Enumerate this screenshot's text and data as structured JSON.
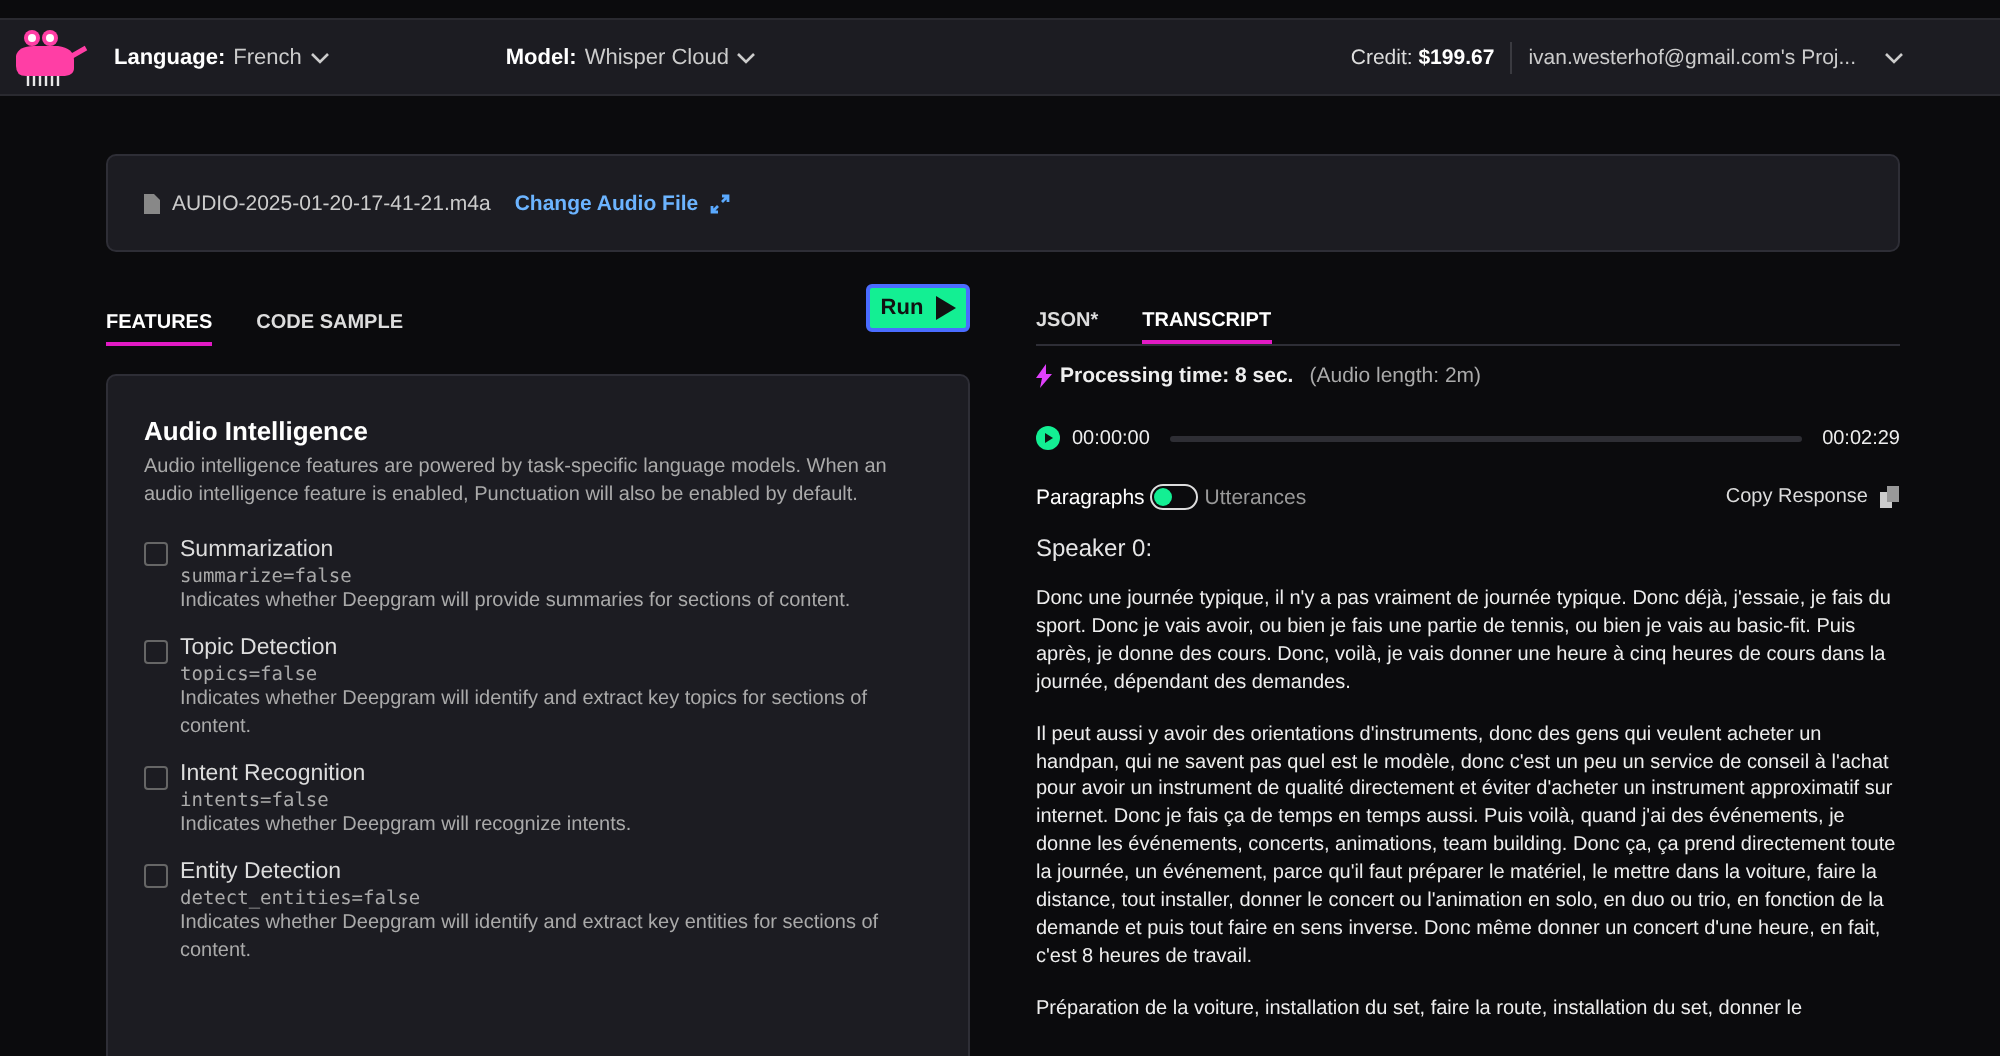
{
  "header": {
    "language_label": "Language:",
    "language": "French",
    "model_label": "Model:",
    "model": "Whisper Cloud",
    "credit_label": "Credit:",
    "credit": "$199.67",
    "project": "ivan.westerhof@gmail.com's Proj..."
  },
  "file": {
    "name": "AUDIO-2025-01-20-17-41-21.m4a",
    "change_link": "Change Audio File"
  },
  "left_tabs": [
    {
      "label": "FEATURES",
      "selected": true
    },
    {
      "label": "CODE SAMPLE",
      "selected": false
    }
  ],
  "run_button": "Run",
  "features_panel": {
    "title": "Audio Intelligence",
    "description": "Audio intelligence features are powered by task-specific language models. When an audio intelligence feature is enabled, Punctuation will also be enabled by default.",
    "items": [
      {
        "name": "Summarization",
        "param": "summarize=false",
        "description": "Indicates whether Deepgram will provide summaries for sections of content.",
        "checked": false
      },
      {
        "name": "Topic Detection",
        "param": "topics=false",
        "description": "Indicates whether Deepgram will identify and extract key topics for sections of content.",
        "checked": false
      },
      {
        "name": "Intent Recognition",
        "param": "intents=false",
        "description": "Indicates whether Deepgram will recognize intents.",
        "checked": false
      },
      {
        "name": "Entity Detection",
        "param": "detect_entities=false",
        "description": "Indicates whether Deepgram will identify and extract key entities for sections of content.",
        "checked": false
      }
    ]
  },
  "right_tabs": [
    {
      "label": "JSON*",
      "selected": false
    },
    {
      "label": "TRANSCRIPT",
      "selected": true
    }
  ],
  "processing": {
    "time": "Processing time: 8 sec.",
    "audio_length": "(Audio length: 2m)"
  },
  "player": {
    "current": "00:00:00",
    "total": "00:02:29",
    "level": 0
  },
  "view_toggle": {
    "left_label": "Paragraphs",
    "right_label": "Utterances",
    "utterances_on": false
  },
  "copy_response": "Copy Response",
  "speaker": "Speaker 0:",
  "paragraphs": [
    "Donc une journée typique, il n'y a pas vraiment de journée typique. Donc déjà, j'essaie, je fais du sport. Donc je vais avoir, ou bien je fais une partie de tennis, ou bien je vais au basic-fit. Puis après, je donne des cours. Donc, voilà, je vais donner une heure à cinq heures de cours dans la journée, dépendant des demandes.",
    "Il peut aussi y avoir des orientations d'instruments, donc des gens qui veulent acheter un handpan, qui ne savent pas quel est le modèle, donc c'est un peu un service de conseil à l'achat pour avoir un instrument de qualité directement et éviter d'acheter un instrument approximatif sur internet. Donc je fais ça de temps en temps aussi. Puis voilà, quand j'ai des événements, je donne les événements, concerts, animations, team building. Donc ça, ça prend directement toute la journée, un événement, parce qu'il faut préparer le matériel, le mettre dans la voiture, faire la distance, tout installer, donner le concert ou l'animation en solo, en duo ou trio, en fonction de la demande et puis tout faire en sens inverse. Donc même donner un concert d'une heure, en fait, c'est 8 heures de travail.",
    "Préparation de la voiture, installation du set, faire la route, installation du set, donner le"
  ]
}
